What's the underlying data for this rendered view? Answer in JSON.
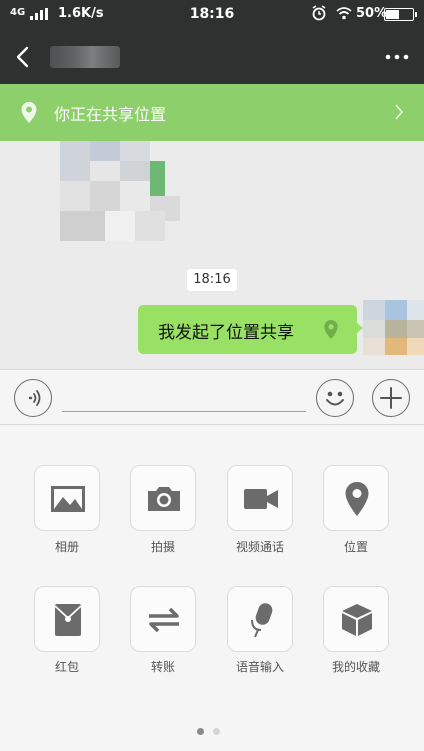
{
  "status_bar": {
    "network": "4G",
    "speed": "1.6K/s",
    "time": "18:16",
    "battery": "50%",
    "battery_level": 0.5,
    "icons": [
      "signal-icon",
      "alarm-icon",
      "wifi-icon",
      "battery-icon"
    ]
  },
  "header": {
    "icons": [
      "back-arrow-icon",
      "more-dots-icon"
    ]
  },
  "banner": {
    "text": "你正在共享位置",
    "icons": [
      "location-pin-icon",
      "chevron-right-icon"
    ]
  },
  "chat": {
    "timestamp": "18:16",
    "messages": [
      {
        "text": "我发起了位置共享",
        "icon": "location-pin-icon",
        "from": "self"
      }
    ]
  },
  "input_bar": {
    "value": "",
    "icons": [
      "voice-icon",
      "emoji-icon",
      "plus-icon"
    ]
  },
  "panel": {
    "items": [
      {
        "label": "相册",
        "icon": "photo-album-icon"
      },
      {
        "label": "拍摄",
        "icon": "camera-icon"
      },
      {
        "label": "视频通话",
        "icon": "video-call-icon"
      },
      {
        "label": "位置",
        "icon": "location-icon"
      },
      {
        "label": "红包",
        "icon": "red-packet-icon"
      },
      {
        "label": "转账",
        "icon": "transfer-icon"
      },
      {
        "label": "语音输入",
        "icon": "microphone-icon"
      },
      {
        "label": "我的收藏",
        "icon": "favorites-box-icon"
      }
    ],
    "page_count": 2,
    "current_page": 1
  },
  "colors": {
    "header_bg": "#2f3030",
    "banner_bg": "#8ccf6b",
    "bubble_bg": "#98e165",
    "icon_gray": "#6b6b6b",
    "input_underline": "#7ac45a"
  }
}
